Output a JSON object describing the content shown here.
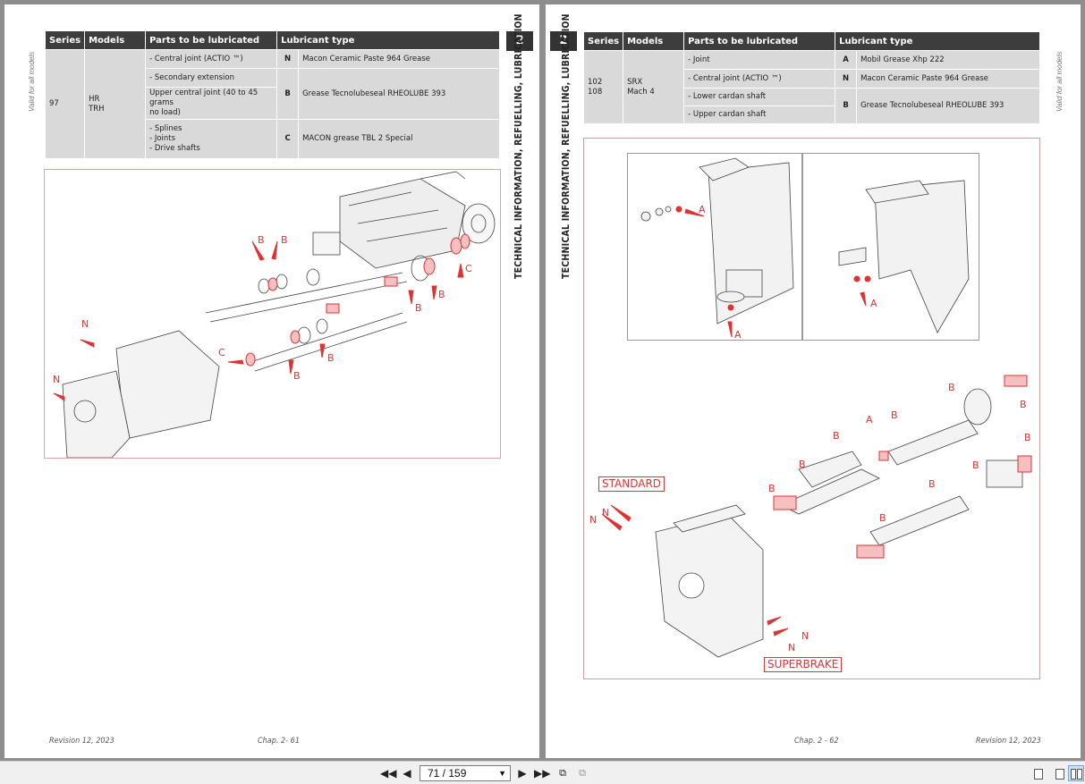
{
  "left_page": {
    "valid_label": "Valid for all models",
    "chapter_number": "2",
    "chapter_title": "TECHNICAL INFORMATION, REFUELLING, LUBRICATION",
    "table": {
      "headers": [
        "Series",
        "Models",
        "Parts to be lubricated",
        "Lubricant type"
      ],
      "series": "97",
      "models": "HR\nTRH",
      "rows": [
        {
          "part": "- Central joint (ACTIO ™)",
          "code": "N",
          "lubricant": "Macon Ceramic Paste 964 Grease"
        },
        {
          "part": "- Secondary extension",
          "code": "B",
          "lubricant": "Grease Tecnolubeseal RHEOLUBE 393"
        },
        {
          "part": "Upper central joint (40 to 45 grams\nno load)"
        },
        {
          "part": "- Splines\n- Joints\n- Drive shafts",
          "code": "C",
          "lubricant": "MACON grease TBL 2 Special"
        }
      ]
    },
    "figure_markers": [
      "B",
      "B",
      "C",
      "B",
      "B",
      "N",
      "C",
      "B",
      "B",
      "N"
    ],
    "footer_revision": "Revision 12, 2023",
    "footer_chapter": "Chap. 2- 61"
  },
  "right_page": {
    "valid_label": "Valid for all models",
    "chapter_number": "2",
    "chapter_title": "TECHNICAL INFORMATION, REFUELLING, LUBRICATION",
    "table": {
      "headers": [
        "Series",
        "Models",
        "Parts to be lubricated",
        "Lubricant type"
      ],
      "series": "102\n108",
      "models": "SRX\nMach 4",
      "rows": [
        {
          "part": "- Joint",
          "code": "A",
          "lubricant": "Mobil Grease Xhp 222"
        },
        {
          "part": "- Central joint (ACTIO ™)",
          "code": "N",
          "lubricant": "Macon Ceramic Paste 964 Grease"
        },
        {
          "part": "- Lower cardan shaft",
          "code": "B",
          "lubricant": "Grease Tecnolubeseal RHEOLUBE 393"
        },
        {
          "part": "- Upper cardan shaft"
        }
      ]
    },
    "figure_markers_top": [
      "A",
      "A",
      "A"
    ],
    "figure_markers_bottom": [
      "B",
      "B",
      "A",
      "B",
      "B",
      "B",
      "B",
      "B",
      "B",
      "B",
      "B",
      "B",
      "N",
      "N",
      "N",
      "N"
    ],
    "standard_label": "STANDARD",
    "superbrake_label": "SUPERBRAKE",
    "footer_chapter": "Chap. 2 - 62",
    "footer_revision": "Revision 12, 2023"
  },
  "toolbar": {
    "page_indicator": "71 / 159",
    "first_icon": "first-page-icon",
    "prev_icon": "previous-page-icon",
    "next_icon": "next-page-icon",
    "last_icon": "last-page-icon",
    "view_modes": [
      "single-page-icon",
      "continuous-page-icon",
      "two-page-icon"
    ],
    "active_view": "two-page-icon"
  },
  "colors": {
    "annotation_red": "#dd3333",
    "header_dark": "#3d3d3d",
    "cell_gray": "#d9d9d9"
  }
}
